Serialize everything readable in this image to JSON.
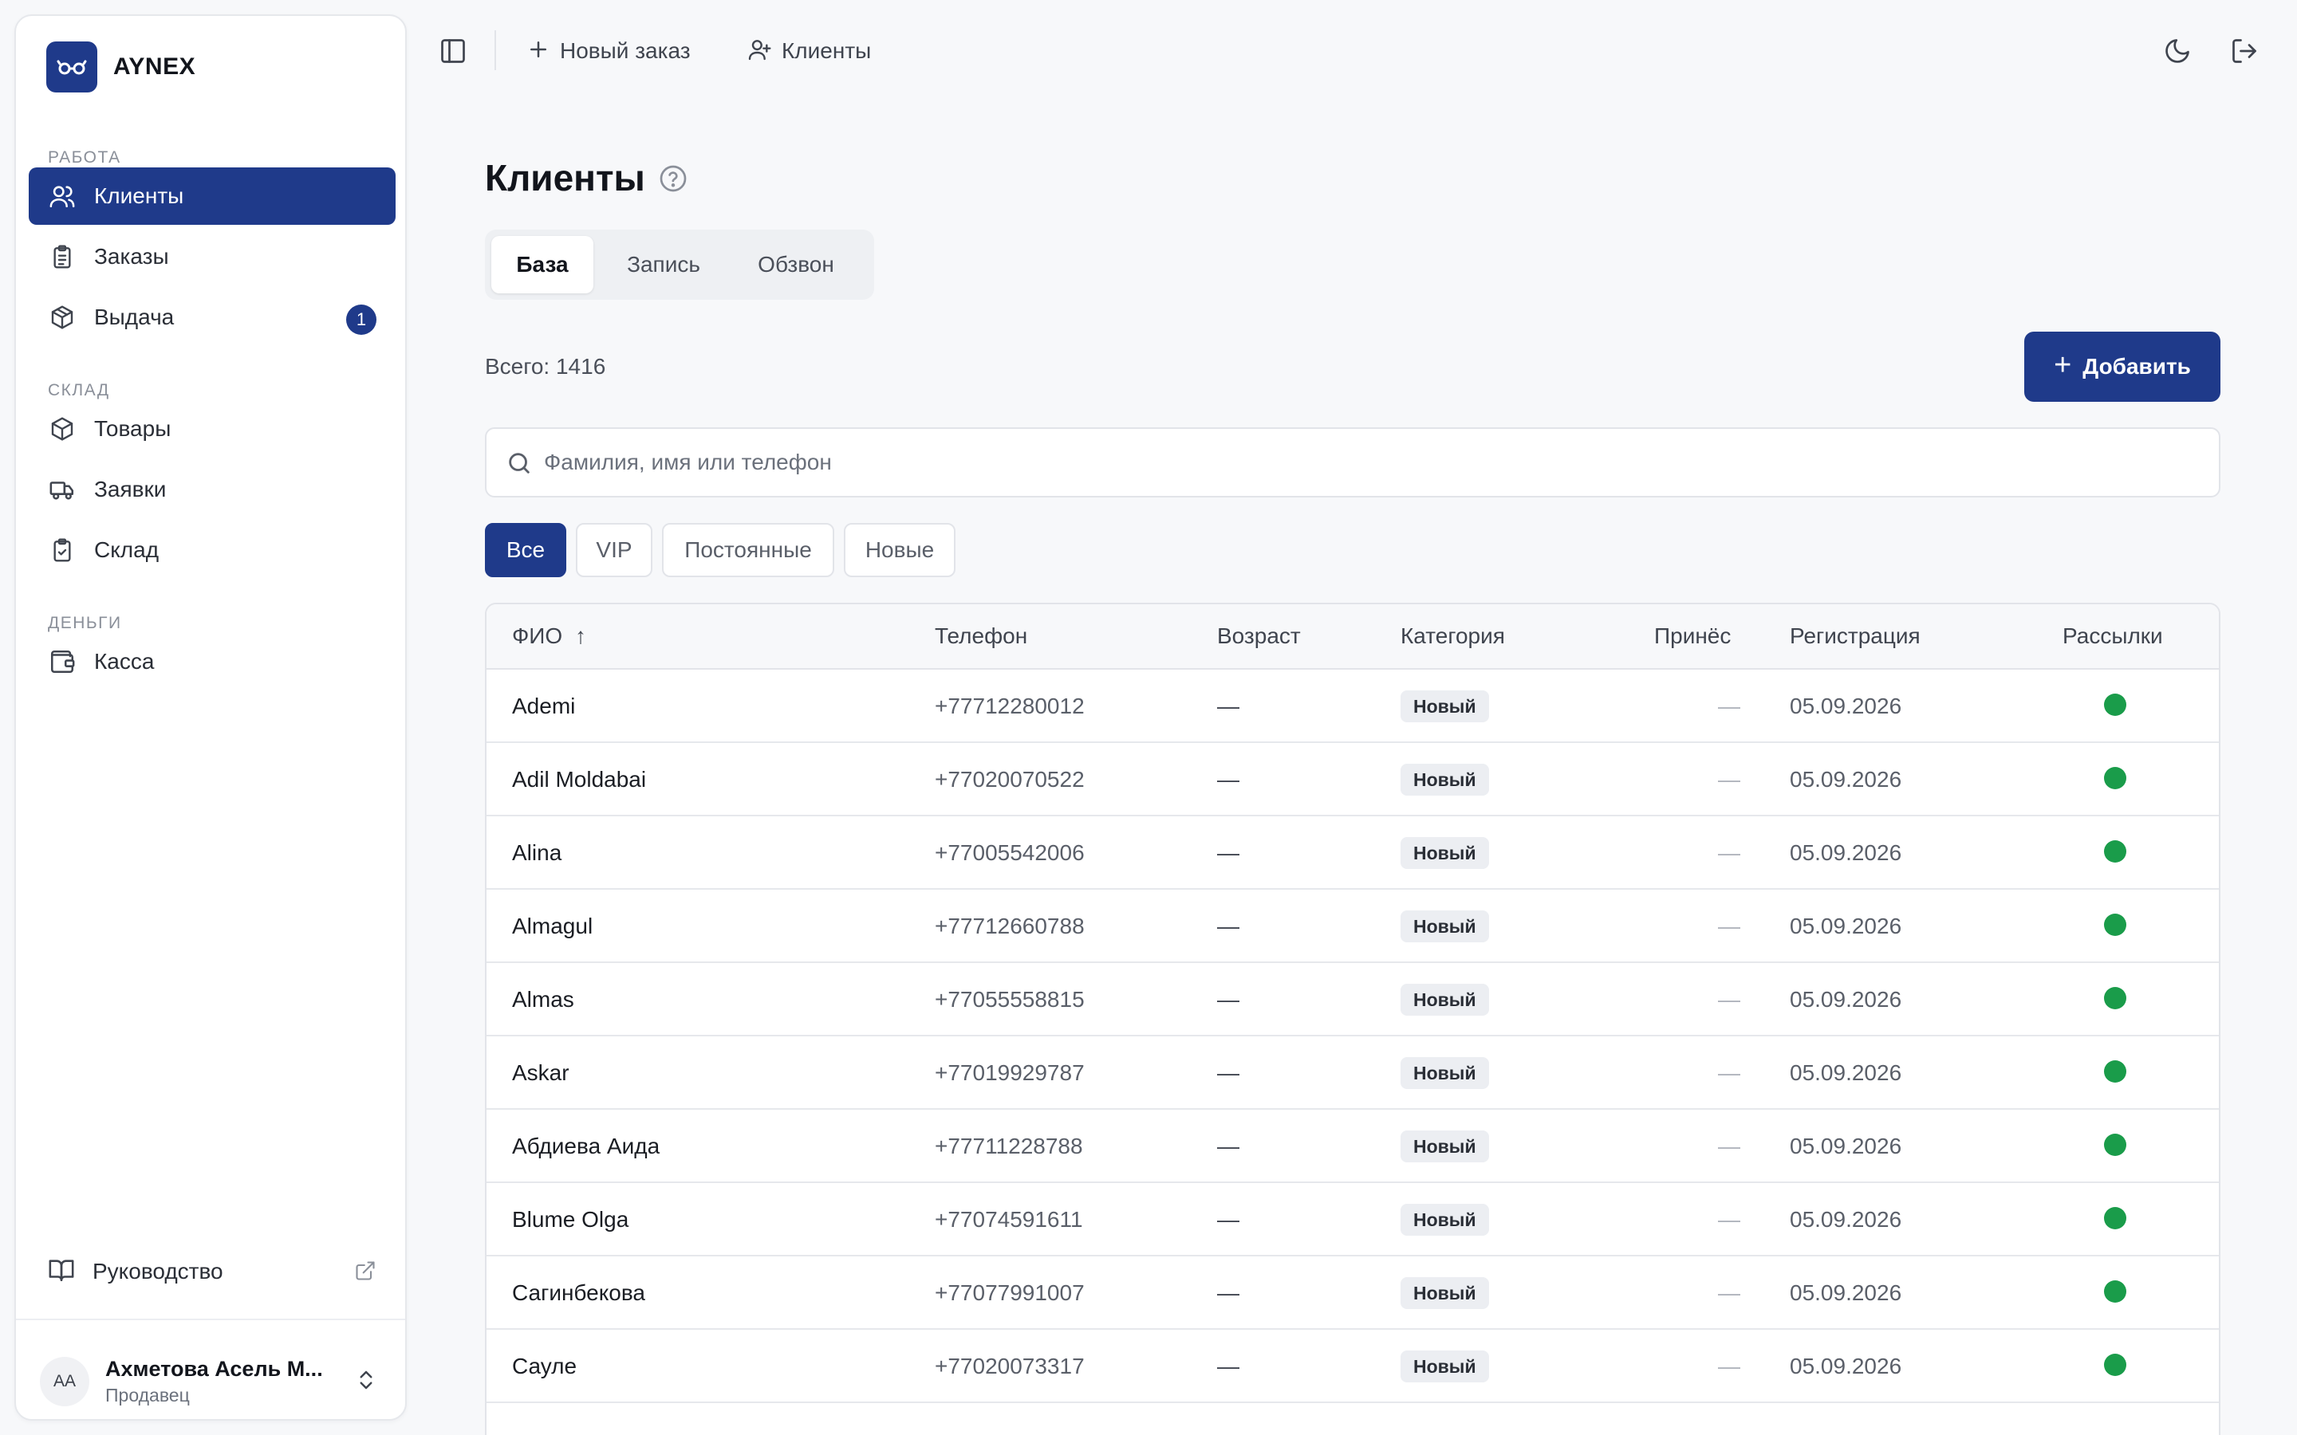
{
  "brand": {
    "name": "AYNEX",
    "logo_icon": "glasses-icon",
    "accent": "#1f3a8a"
  },
  "sidebar": {
    "sections": [
      {
        "label": "РАБОТА"
      },
      {
        "label": "СКЛАД"
      },
      {
        "label": "ДЕНЬГИ"
      }
    ],
    "items": [
      {
        "label": "Клиенты",
        "icon": "users-icon",
        "active": true
      },
      {
        "label": "Заказы",
        "icon": "clipboard-icon"
      },
      {
        "label": "Выдача",
        "icon": "package-icon",
        "badge": "1"
      },
      {
        "label": "Товары",
        "icon": "box-icon"
      },
      {
        "label": "Заявки",
        "icon": "truck-icon"
      },
      {
        "label": "Склад",
        "icon": "clipboard-check-icon"
      },
      {
        "label": "Касса",
        "icon": "wallet-icon"
      }
    ],
    "guide": {
      "label": "Руководство"
    },
    "user": {
      "initials": "AA",
      "name": "Ахметова Асель М...",
      "role": "Продавец"
    }
  },
  "topbar": {
    "new_order": "Новый заказ",
    "clients": "Клиенты"
  },
  "main": {
    "title": "Клиенты",
    "tabs": [
      "База",
      "Запись",
      "Обзвон"
    ],
    "total": "Всего: 1416",
    "add_button": "Добавить",
    "search_placeholder": "Фамилия, имя или телефон",
    "filters": [
      "Все",
      "VIP",
      "Постоянные",
      "Новые"
    ]
  },
  "table": {
    "columns": [
      "ФИО",
      "Телефон",
      "Возраст",
      "Категория",
      "Принёс",
      "Регистрация",
      "Рассылки"
    ],
    "sort_indicator": "↑",
    "rows": [
      {
        "name": "Ademi",
        "phone": "+77712280012",
        "age": "—",
        "category": "Новый",
        "brought": "—",
        "registered": "05.09.2026",
        "mailing": true
      },
      {
        "name": "Adil Moldabai",
        "phone": "+77020070522",
        "age": "—",
        "category": "Новый",
        "brought": "—",
        "registered": "05.09.2026",
        "mailing": true
      },
      {
        "name": "Alina",
        "phone": "+77005542006",
        "age": "—",
        "category": "Новый",
        "brought": "—",
        "registered": "05.09.2026",
        "mailing": true
      },
      {
        "name": "Almagul",
        "phone": "+77712660788",
        "age": "—",
        "category": "Новый",
        "brought": "—",
        "registered": "05.09.2026",
        "mailing": true
      },
      {
        "name": "Almas",
        "phone": "+77055558815",
        "age": "—",
        "category": "Новый",
        "brought": "—",
        "registered": "05.09.2026",
        "mailing": true
      },
      {
        "name": "Askar",
        "phone": "+77019929787",
        "age": "—",
        "category": "Новый",
        "brought": "—",
        "registered": "05.09.2026",
        "mailing": true
      },
      {
        "name": "Абдиева Аида",
        "phone": "+77711228788",
        "age": "—",
        "category": "Новый",
        "brought": "—",
        "registered": "05.09.2026",
        "mailing": true
      },
      {
        "name": "Blume Olga",
        "phone": "+77074591611",
        "age": "—",
        "category": "Новый",
        "brought": "—",
        "registered": "05.09.2026",
        "mailing": true
      },
      {
        "name": "Сагинбекова",
        "phone": "+77077991007",
        "age": "—",
        "category": "Новый",
        "brought": "—",
        "registered": "05.09.2026",
        "mailing": true
      },
      {
        "name": "Сауле",
        "phone": "+77020073317",
        "age": "—",
        "category": "Новый",
        "brought": "—",
        "registered": "05.09.2026",
        "mailing": true
      }
    ],
    "status_color": "#1a9c4a"
  }
}
